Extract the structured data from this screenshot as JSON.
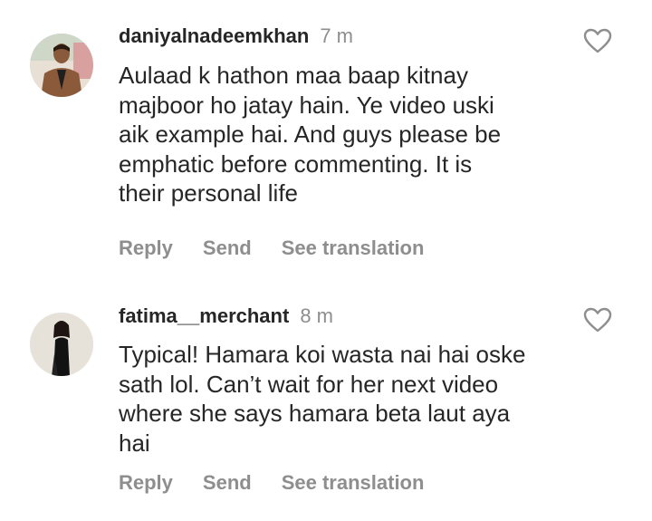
{
  "comments": [
    {
      "username": "daniyalnadeemkhan",
      "time": "7 m",
      "text": "Aulaad k hathon maa baap kitnay\nmajboor ho jatay hain. Ye video uski\naik example hai. And guys please be\nemphatic before commenting. It is\ntheir personal life",
      "actions": {
        "reply": "Reply",
        "send": "Send",
        "translate": "See translation"
      },
      "icons": {
        "like": "heart-outline-icon",
        "avatar": "man-in-brown-jacket-avatar"
      }
    },
    {
      "username": "fatima__merchant",
      "time": "8 m",
      "text": "Typical! Hamara koi wasta nai hai oske\nsath lol. Can’t wait for her next video\nwhere she says hamara beta laut aya\nhai",
      "actions": {
        "reply": "Reply",
        "send": "Send",
        "translate": "See translation"
      },
      "icons": {
        "like": "heart-outline-icon",
        "avatar": "woman-in-black-dress-avatar"
      }
    }
  ],
  "colors": {
    "text": "#262626",
    "muted": "#8e8e8e",
    "background": "#ffffff"
  }
}
